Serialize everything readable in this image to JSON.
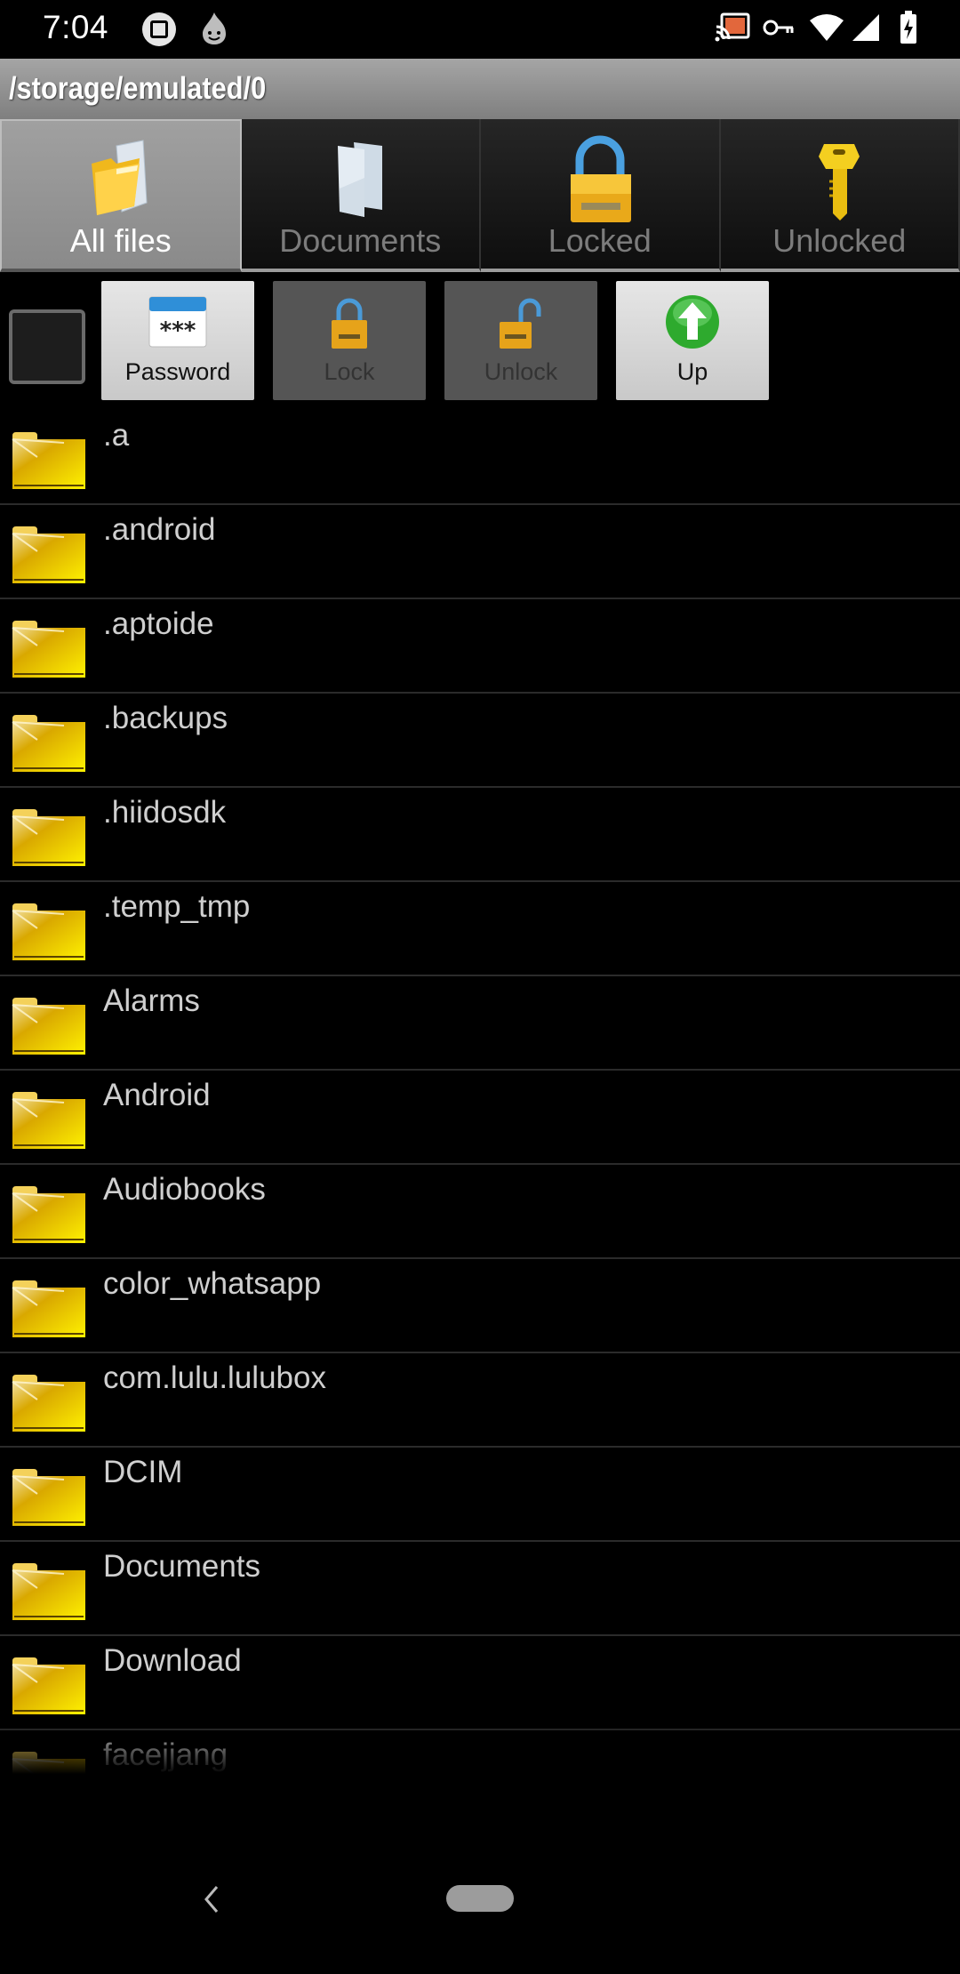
{
  "status_bar": {
    "time": "7:04",
    "left_icons": [
      "screenshot-edit-icon",
      "hola-flame-icon"
    ],
    "right_icons": [
      "cast-icon",
      "vpn-key-icon",
      "wifi-icon",
      "cell-signal-icon",
      "battery-charging-icon"
    ]
  },
  "header": {
    "path": "/storage/emulated/0"
  },
  "tabs": [
    {
      "label": "All files",
      "icon": "folder-icon",
      "active": true
    },
    {
      "label": "Documents",
      "icon": "documents-icon",
      "active": false
    },
    {
      "label": "Locked",
      "icon": "padlock-icon",
      "active": false
    },
    {
      "label": "Unlocked",
      "icon": "key-icon",
      "active": false
    }
  ],
  "toolbar": {
    "select_all_checked": false,
    "buttons": [
      {
        "label": "Password",
        "icon": "password-icon",
        "enabled": true
      },
      {
        "label": "Lock",
        "icon": "lock-icon",
        "enabled": false
      },
      {
        "label": "Unlock",
        "icon": "unlock-icon",
        "enabled": false
      },
      {
        "label": "Up",
        "icon": "up-arrow-icon",
        "enabled": true
      }
    ]
  },
  "files": [
    {
      "name": ".a",
      "type": "folder"
    },
    {
      "name": ".android",
      "type": "folder"
    },
    {
      "name": ".aptoide",
      "type": "folder"
    },
    {
      "name": ".backups",
      "type": "folder"
    },
    {
      "name": ".hiidosdk",
      "type": "folder"
    },
    {
      "name": ".temp_tmp",
      "type": "folder"
    },
    {
      "name": "Alarms",
      "type": "folder"
    },
    {
      "name": "Android",
      "type": "folder"
    },
    {
      "name": "Audiobooks",
      "type": "folder"
    },
    {
      "name": "color_whatsapp",
      "type": "folder"
    },
    {
      "name": "com.lulu.lulubox",
      "type": "folder"
    },
    {
      "name": "DCIM",
      "type": "folder"
    },
    {
      "name": "Documents",
      "type": "folder"
    },
    {
      "name": "Download",
      "type": "folder"
    },
    {
      "name": "facejjang",
      "type": "folder"
    }
  ],
  "colors": {
    "folder": "#e8b800",
    "up_button": "#2eaa2e",
    "shackle": "#4aa0e0"
  }
}
